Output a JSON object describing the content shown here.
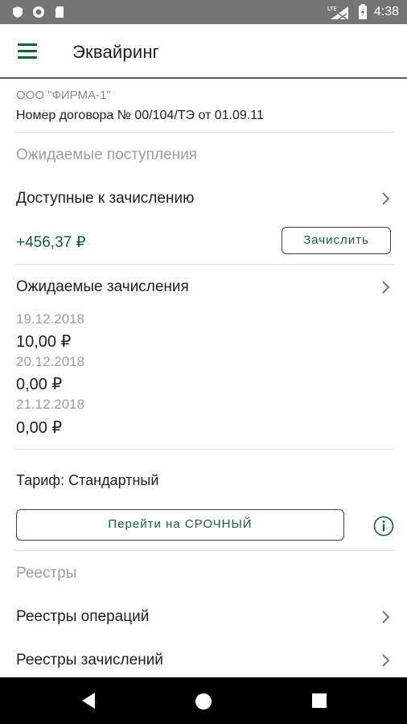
{
  "status_bar": {
    "time": "4:38",
    "left_icons": [
      "shield-icon",
      "circle-icon",
      "sd-card-icon"
    ],
    "right_icons": [
      "signal-lte-icon",
      "battery-icon"
    ]
  },
  "app_bar": {
    "title": "Эквайринг",
    "menu_icon": "hamburger-menu-icon"
  },
  "header": {
    "company": "ООО \"ФИРМА-1\"",
    "contract": "Номер договора № 00/104/ТЭ от 01.09.11"
  },
  "expected_receipts": {
    "section_title": "Ожидаемые поступления",
    "available": {
      "label": "Доступные к зачислению",
      "amount": "+456,37 ₽",
      "button_label": "Зачислить"
    },
    "expected": {
      "label": "Ожидаемые зачисления",
      "items": [
        {
          "date": "19.12.2018",
          "value": "10,00 ₽"
        },
        {
          "date": "20.12.2018",
          "value": "0,00 ₽"
        },
        {
          "date": "21.12.2018",
          "value": "0,00 ₽"
        }
      ]
    }
  },
  "tariff": {
    "label": "Тариф: Стандартный",
    "button_label": "Перейти на СРОЧНЫЙ",
    "info_icon": "info-icon"
  },
  "registries": {
    "section_title": "Реестры",
    "items": [
      {
        "label": "Реестры операций"
      },
      {
        "label": "Реестры зачислений"
      }
    ]
  },
  "nav_bar": {
    "buttons": [
      "back-icon",
      "home-icon",
      "recents-icon"
    ]
  },
  "colors": {
    "accent_green": "#1b5e3a",
    "status_bar": "#757575",
    "nav_bar": "#000000",
    "muted_text": "#9e9e9e"
  }
}
